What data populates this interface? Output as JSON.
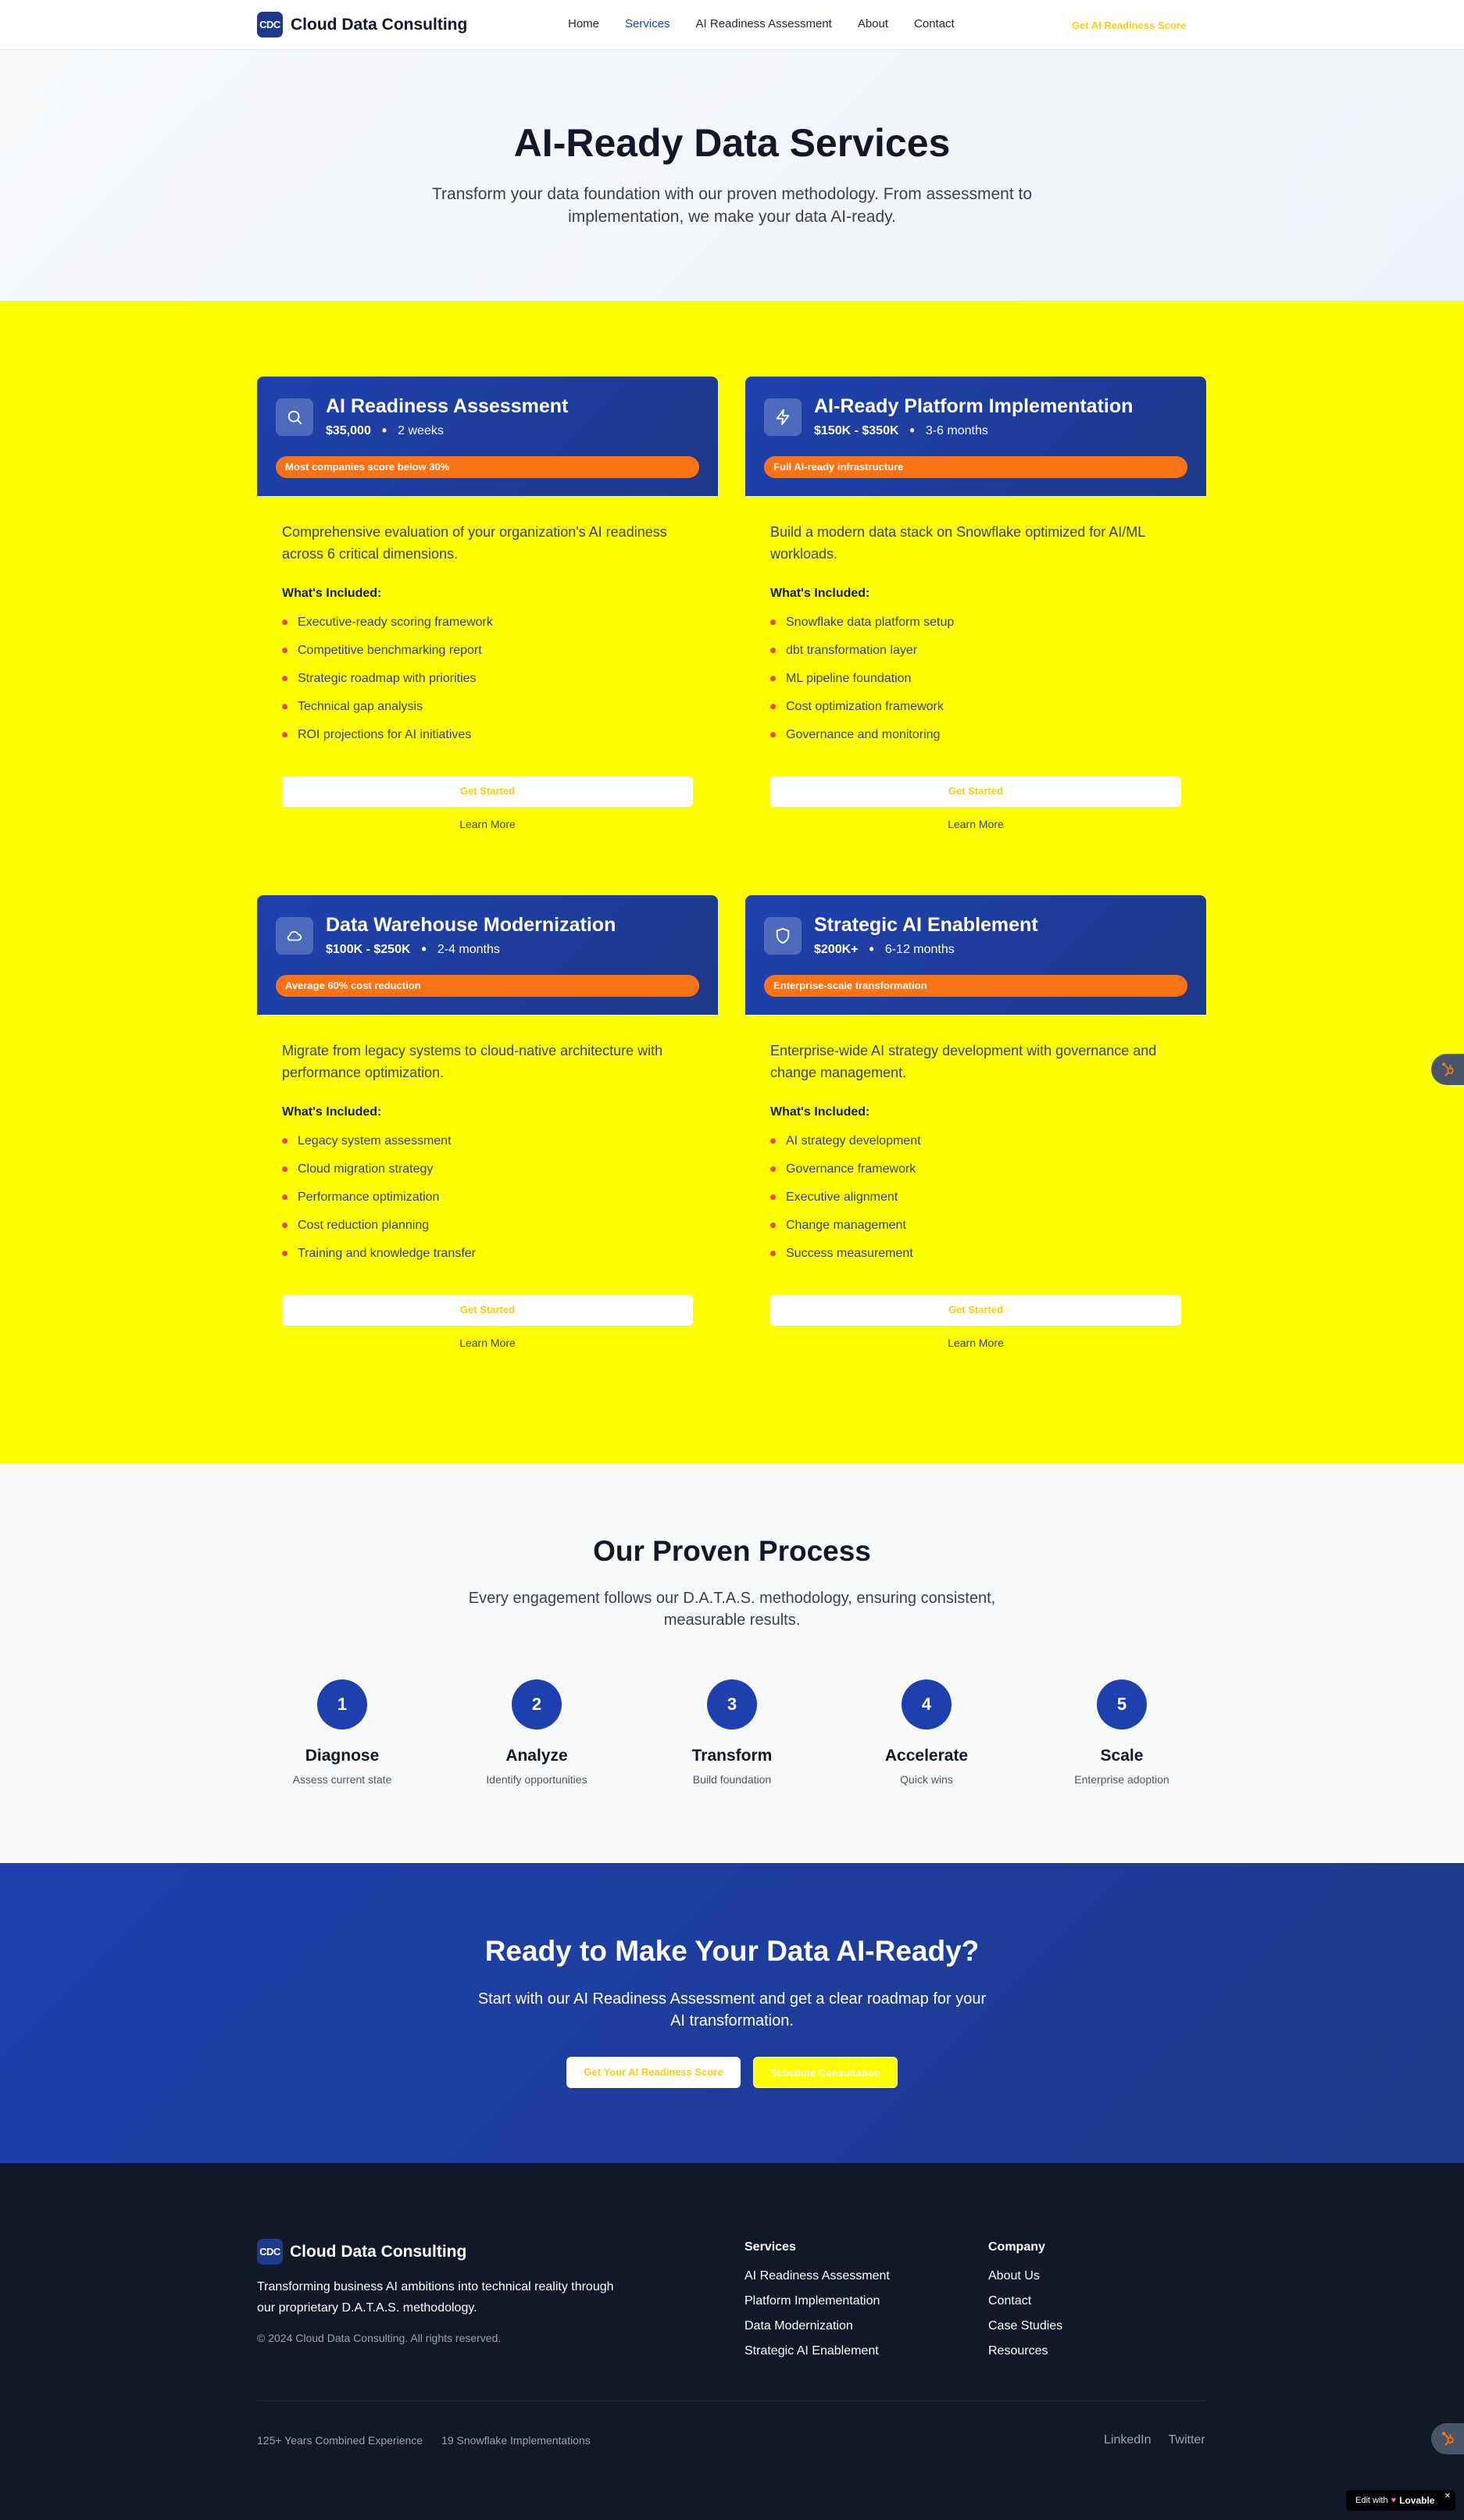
{
  "nav": {
    "logo_badge": "CDC",
    "brand": "Cloud Data Consulting",
    "links": [
      "Home",
      "Services",
      "AI Readiness Assessment",
      "About",
      "Contact"
    ],
    "active_link": "Services",
    "cta": "Get AI Readiness Score"
  },
  "hero": {
    "title": "AI-Ready Data Services",
    "subtitle": "Transform your data foundation with our proven methodology. From assessment to implementation, we make your data AI-ready."
  },
  "services": [
    {
      "title": "AI Readiness Assessment",
      "price": "$35,000",
      "duration": "2 weeks",
      "icon": "search-icon",
      "badge": "Most companies score below 30%",
      "description": "Comprehensive evaluation of your organization's AI readiness across 6 critical dimensions.",
      "included_label": "What's Included:",
      "features": [
        "Executive-ready scoring framework",
        "Competitive benchmarking report",
        "Strategic roadmap with priorities",
        "Technical gap analysis",
        "ROI projections for AI initiatives"
      ],
      "cta": "Get Started",
      "learn_more": "Learn More"
    },
    {
      "title": "AI-Ready Platform Implementation",
      "price": "$150K - $350K",
      "duration": "3-6 months",
      "icon": "lightning-icon",
      "badge": "Full AI-ready infrastructure",
      "description": "Build a modern data stack on Snowflake optimized for AI/ML workloads.",
      "included_label": "What's Included:",
      "features": [
        "Snowflake data platform setup",
        "dbt transformation layer",
        "ML pipeline foundation",
        "Cost optimization framework",
        "Governance and monitoring"
      ],
      "cta": "Get Started",
      "learn_more": "Learn More"
    },
    {
      "title": "Data Warehouse Modernization",
      "price": "$100K - $250K",
      "duration": "2-4 months",
      "icon": "cloud-icon",
      "badge": "Average 60% cost reduction",
      "description": "Migrate from legacy systems to cloud-native architecture with performance optimization.",
      "included_label": "What's Included:",
      "features": [
        "Legacy system assessment",
        "Cloud migration strategy",
        "Performance optimization",
        "Cost reduction planning",
        "Training and knowledge transfer"
      ],
      "cta": "Get Started",
      "learn_more": "Learn More"
    },
    {
      "title": "Strategic AI Enablement",
      "price": "$200K+",
      "duration": "6-12 months",
      "icon": "shield-icon",
      "badge": "Enterprise-scale transformation",
      "description": "Enterprise-wide AI strategy development with governance and change management.",
      "included_label": "What's Included:",
      "features": [
        "AI strategy development",
        "Governance framework",
        "Executive alignment",
        "Change management",
        "Success measurement"
      ],
      "cta": "Get Started",
      "learn_more": "Learn More"
    }
  ],
  "process": {
    "title": "Our Proven Process",
    "subtitle": "Every engagement follows our D.A.T.A.S. methodology, ensuring consistent, measurable results.",
    "steps": [
      {
        "num": "1",
        "title": "Diagnose",
        "desc": "Assess current state"
      },
      {
        "num": "2",
        "title": "Analyze",
        "desc": "Identify opportunities"
      },
      {
        "num": "3",
        "title": "Transform",
        "desc": "Build foundation"
      },
      {
        "num": "4",
        "title": "Accelerate",
        "desc": "Quick wins"
      },
      {
        "num": "5",
        "title": "Scale",
        "desc": "Enterprise adoption"
      }
    ]
  },
  "cta": {
    "title": "Ready to Make Your Data AI-Ready?",
    "subtitle": "Start with our AI Readiness Assessment and get a clear roadmap for your AI transformation.",
    "primary": "Get Your AI Readiness Score",
    "secondary": "Schedule Consultation"
  },
  "footer": {
    "logo_badge": "CDC",
    "brand": "Cloud Data Consulting",
    "tagline": "Transforming business AI ambitions into technical reality through our proprietary D.A.T.A.S. methodology.",
    "copyright": "© 2024 Cloud Data Consulting. All rights reserved.",
    "services_heading": "Services",
    "services_links": [
      "AI Readiness Assessment",
      "Platform Implementation",
      "Data Modernization",
      "Strategic AI Enablement"
    ],
    "company_heading": "Company",
    "company_links": [
      "About Us",
      "Contact",
      "Case Studies",
      "Resources"
    ],
    "stats": [
      "125+ Years Combined Experience",
      "19 Snowflake Implementations"
    ],
    "social": [
      "LinkedIn",
      "Twitter"
    ]
  },
  "badge": {
    "edit_with": "Edit with",
    "lovable": "Lovable",
    "close": "✕"
  },
  "colors": {
    "primary": "#1e40af",
    "accent_orange": "#f97316",
    "services_bg": "#ffff00",
    "footer_bg": "#111827",
    "bullet": "#ef4444"
  }
}
